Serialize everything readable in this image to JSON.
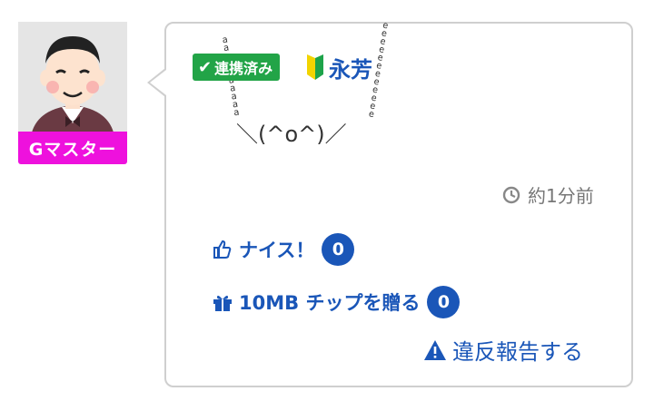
{
  "user": {
    "rank_badge": "Gマスター",
    "link_badge": "連携済み",
    "name": "永芳"
  },
  "post": {
    "kaomoji": "＼(^o^)／",
    "chain_char": "a",
    "chain_char_right": "e",
    "time": "約1分前"
  },
  "actions": {
    "nice_label": "ナイス！",
    "nice_count": "0",
    "tip_label": "10MB チップを贈る",
    "tip_count": "0",
    "report_label": "違反報告する"
  },
  "colors": {
    "accent_blue": "#1a56b8",
    "rank_magenta": "#ee11dd",
    "link_green": "#22a447"
  },
  "icons": [
    "person-avatar",
    "check-icon",
    "beginner-mark-icon",
    "clock-icon",
    "thumbs-up-icon",
    "gift-icon",
    "warning-icon"
  ]
}
